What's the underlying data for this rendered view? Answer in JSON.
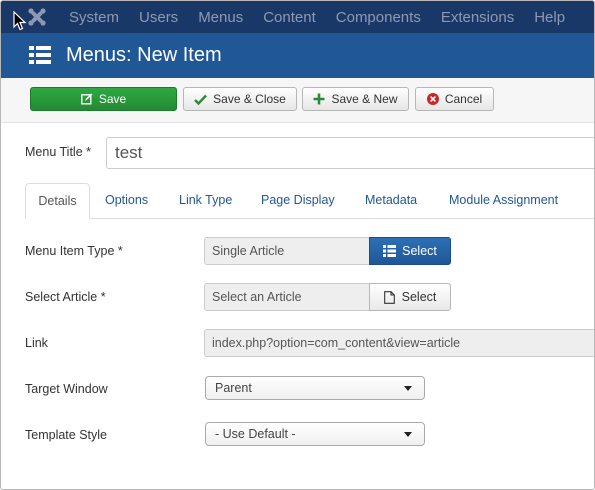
{
  "topmenu": {
    "items": [
      "System",
      "Users",
      "Menus",
      "Content",
      "Components",
      "Extensions",
      "Help"
    ]
  },
  "header": {
    "title": "Menus: New Item"
  },
  "toolbar": {
    "save_label": "Save",
    "save_close_label": "Save & Close",
    "save_new_label": "Save & New",
    "cancel_label": "Cancel"
  },
  "form": {
    "menu_title_label": "Menu Title *",
    "menu_title_value": "test"
  },
  "tabs": [
    "Details",
    "Options",
    "Link Type",
    "Page Display",
    "Metadata",
    "Module Assignment"
  ],
  "details": {
    "menu_item_type_label": "Menu Item Type *",
    "menu_item_type_value": "Single Article",
    "menu_item_type_button": "Select",
    "select_article_label": "Select Article *",
    "select_article_value": "Select an Article",
    "select_article_button": "Select",
    "link_label": "Link",
    "link_value": "index.php?option=com_content&view=article",
    "target_window_label": "Target Window",
    "target_window_value": "Parent",
    "template_style_label": "Template Style",
    "template_style_value": "- Use Default -"
  },
  "colors": {
    "topbar": "#1a3867",
    "titlebar": "#1f5797",
    "save_green": "#2fa842",
    "link_blue": "#1f5797",
    "cancel_red": "#c52827"
  }
}
